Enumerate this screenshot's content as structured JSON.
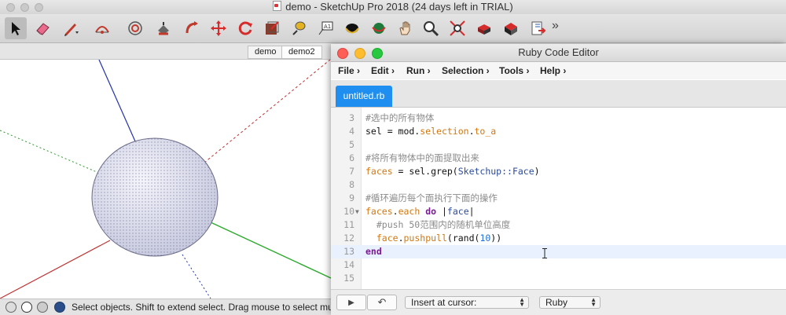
{
  "sketchup": {
    "title": "demo - SketchUp Pro 2018 (24 days left in TRIAL)",
    "toolbar_icons": [
      "select-arrow-icon",
      "eraser-icon",
      "pencil-line-icon",
      "arc-icon",
      "offset-circle-icon",
      "paint-bucket-icon",
      "follow-me-icon",
      "move-icon",
      "rotate-icon",
      "scale-icon",
      "tape-measure-icon",
      "text-label-icon",
      "orbit-icon",
      "orbit-alt-icon",
      "pan-hand-icon",
      "zoom-icon",
      "zoom-extents-icon",
      "model-info-icon",
      "3d-warehouse-icon",
      "export-icon"
    ],
    "more_glyph": "»",
    "scene_tabs": [
      "demo",
      "demo2"
    ],
    "status_text": "Select objects. Shift to extend select. Drag mouse to select multi"
  },
  "editor": {
    "title": "Ruby Code Editor",
    "menus": [
      "File ›",
      "Edit ›",
      "Run ›",
      "Selection ›",
      "Tools ›",
      "Help ›"
    ],
    "tab": "untitled.rb",
    "lines": [
      {
        "n": "3",
        "text": "#选中的所有物体"
      },
      {
        "n": "4",
        "text": "sel = mod.selection.to_a"
      },
      {
        "n": "5",
        "text": ""
      },
      {
        "n": "6",
        "text": "#将所有物体中的面提取出来"
      },
      {
        "n": "7",
        "text": "faces = sel.grep(Sketchup::Face)"
      },
      {
        "n": "8",
        "text": ""
      },
      {
        "n": "9",
        "text": "#循环遍历每个面执行下面的操作"
      },
      {
        "n": "10",
        "text": "faces.each do |face|"
      },
      {
        "n": "11",
        "text": "  #push 50范围内的随机单位高度"
      },
      {
        "n": "12",
        "text": "  face.pushpull(rand(10))"
      },
      {
        "n": "13",
        "text": "end"
      },
      {
        "n": "14",
        "text": ""
      },
      {
        "n": "15",
        "text": ""
      }
    ],
    "run_glyph": "▶",
    "undo_glyph": "↶",
    "insert_mode": "Insert at cursor:",
    "language": "Ruby",
    "colors": {
      "tab_active": "#1e8ef0",
      "keyword": "#7a1a94",
      "method": "#d3770f",
      "number": "#1d6fd6",
      "comment": "#8b8b8b"
    }
  }
}
